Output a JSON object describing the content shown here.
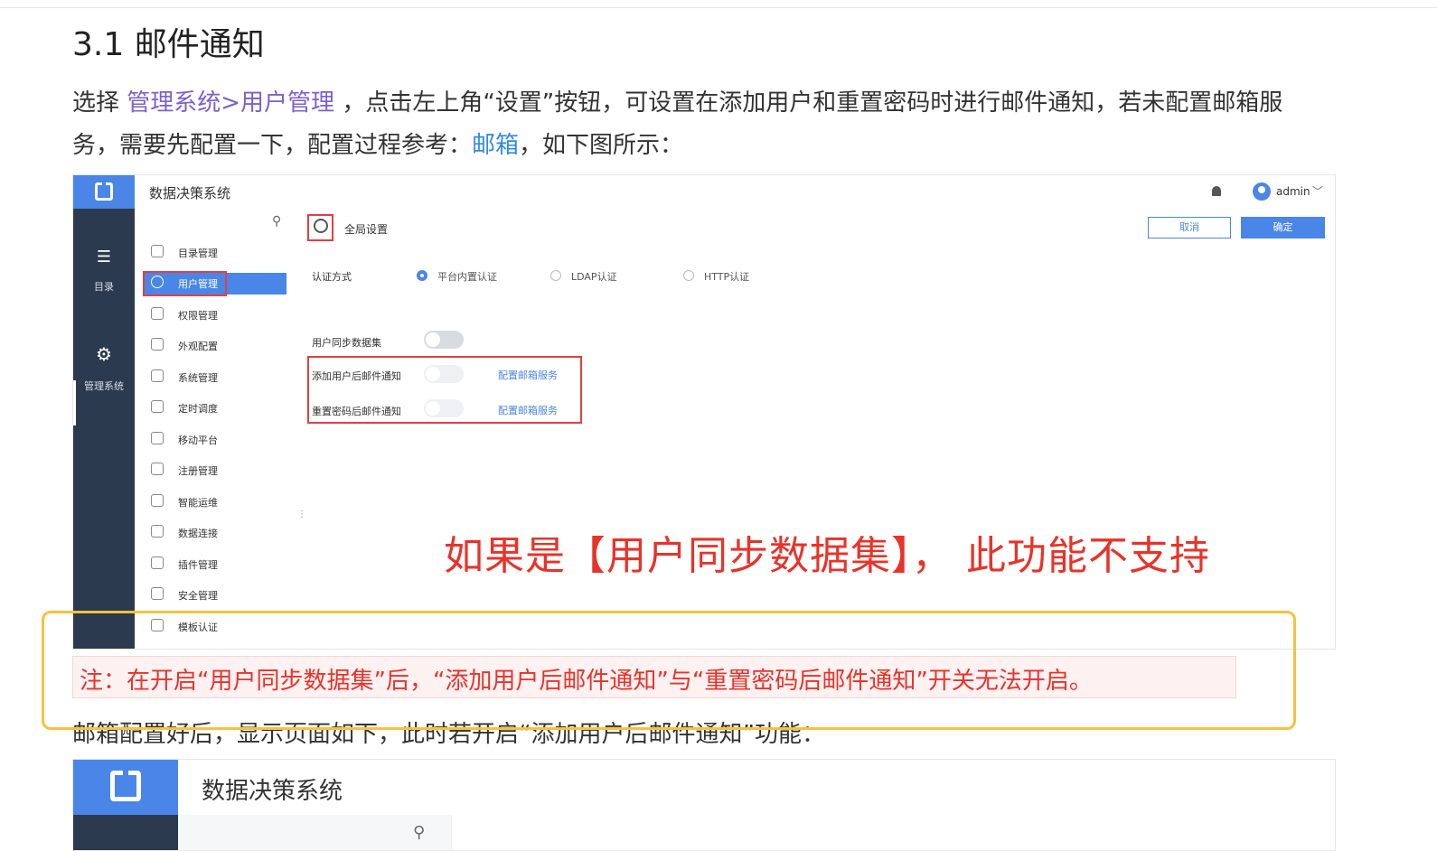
{
  "doc": {
    "section_title": "3.1 邮件通知",
    "para1_prefix": "选择 ",
    "para1_link": "管理系统>用户管理",
    "para1_suffix": " ，点击左上角“设置”按钮，可设置在添加用户和重置密码时进行邮件通知，若未配置邮箱服",
    "para2_prefix": "务，需要先配置一下，配置过程参考：",
    "para2_link": "邮箱",
    "para2_suffix": "，如下图所示：",
    "note": "注：在开启“用户同步数据集”后，“添加用户后邮件通知”与“重置密码后邮件通知”开关无法开启。",
    "para3": "邮箱配置好后，显示页面如下，此时若开启“添加用户后邮件通知”功能："
  },
  "shot1": {
    "app_title": "数据决策系统",
    "user": "admin",
    "nav": [
      {
        "label": "目录",
        "icon": "list-icon"
      },
      {
        "label": "管理系统",
        "icon": "gear-icon"
      }
    ],
    "menu": [
      {
        "label": "目录管理",
        "icon": "catalog-icon"
      },
      {
        "label": "用户管理",
        "icon": "user-icon"
      },
      {
        "label": "权限管理",
        "icon": "lock-icon"
      },
      {
        "label": "外观配置",
        "icon": "paint-roller-icon"
      },
      {
        "label": "系统管理",
        "icon": "settings-icon"
      },
      {
        "label": "定时调度",
        "icon": "clock-icon"
      },
      {
        "label": "移动平台",
        "icon": "mobile-icon"
      },
      {
        "label": "注册管理",
        "icon": "register-icon"
      },
      {
        "label": "智能运维",
        "icon": "ops-icon"
      },
      {
        "label": "数据连接",
        "icon": "link-icon"
      },
      {
        "label": "插件管理",
        "icon": "puzzle-icon"
      },
      {
        "label": "安全管理",
        "icon": "shield-icon"
      },
      {
        "label": "模板认证",
        "icon": "template-icon"
      }
    ],
    "header_title": "全局设置",
    "cancel": "取消",
    "ok": "确定",
    "auth_label": "认证方式",
    "auth_options": [
      "平台内置认证",
      "LDAP认证",
      "HTTP认证"
    ],
    "sync_label": "用户同步数据集",
    "add_mail_label": "添加用户后邮件通知",
    "reset_mail_label": "重置密码后邮件通知",
    "config_mail_link": "配置邮箱服务",
    "annotation": "如果是【用户同步数据集】， 此功能不支持"
  },
  "shot2": {
    "app_title": "数据决策系统"
  },
  "colors": {
    "accent": "#4a86e8",
    "sidebar": "#2c3a4f",
    "annotation_red": "#e8332a",
    "highlight_yellow": "#f5c240"
  }
}
